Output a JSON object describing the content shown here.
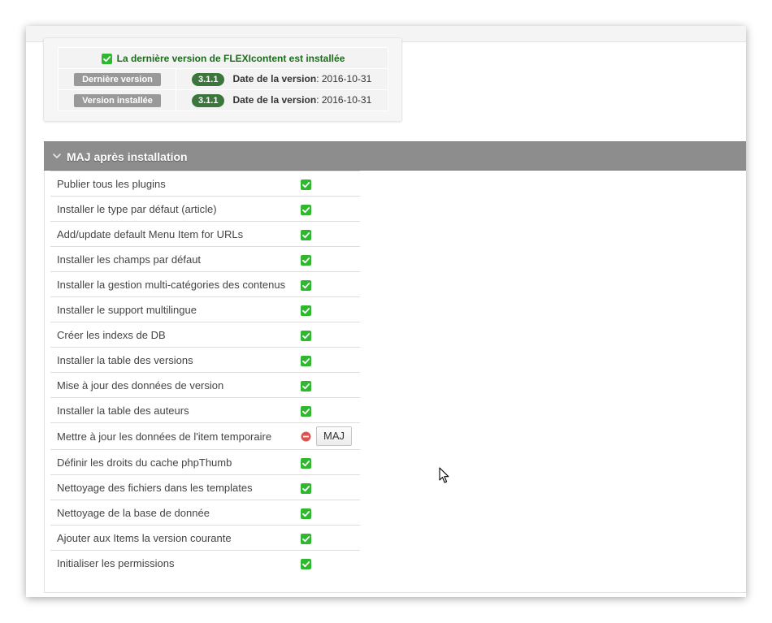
{
  "version_info": {
    "status_message": "La dernière version de FLEXIcontent est installée",
    "rows": [
      {
        "label": "Dernière version",
        "version": "3.1.1",
        "date_label": "Date de la version",
        "date_value": ": 2016-10-31"
      },
      {
        "label": "Version installée",
        "version": "3.1.1",
        "date_label": "Date de la version",
        "date_value": ": 2016-10-31"
      }
    ]
  },
  "section": {
    "title": "MAJ après installation"
  },
  "tasks": [
    {
      "name": "Publier tous les plugins",
      "status": "ok"
    },
    {
      "name": "Installer le type par défaut (article)",
      "status": "ok"
    },
    {
      "name": "Add/update default Menu Item for URLs",
      "status": "ok"
    },
    {
      "name": "Installer les champs par défaut",
      "status": "ok"
    },
    {
      "name": "Installer la gestion multi-catégories des contenus",
      "status": "ok"
    },
    {
      "name": "Installer le support multilingue",
      "status": "ok"
    },
    {
      "name": "Créer les indexs de DB",
      "status": "ok"
    },
    {
      "name": "Installer la table des versions",
      "status": "ok"
    },
    {
      "name": "Mise à jour des données de version",
      "status": "ok"
    },
    {
      "name": "Installer la table des auteurs",
      "status": "ok"
    },
    {
      "name": "Mettre à jour les données de l'item temporaire",
      "status": "error",
      "button_label": "MAJ"
    },
    {
      "name": "Définir les droits du cache phpThumb",
      "status": "ok"
    },
    {
      "name": "Nettoyage des fichiers dans les templates",
      "status": "ok"
    },
    {
      "name": "Nettoyage de la base de donnée",
      "status": "ok"
    },
    {
      "name": "Ajouter aux Items la version courante",
      "status": "ok"
    },
    {
      "name": "Initialiser les permissions",
      "status": "ok"
    }
  ],
  "colors": {
    "success_green": "#3c763d",
    "check_green": "#2fb82f",
    "header_gray": "#8d8d8d",
    "error_red": "#d9534f"
  },
  "icons": {
    "ok": "check-icon",
    "error": "error-icon",
    "section": "chevron-down-icon"
  }
}
